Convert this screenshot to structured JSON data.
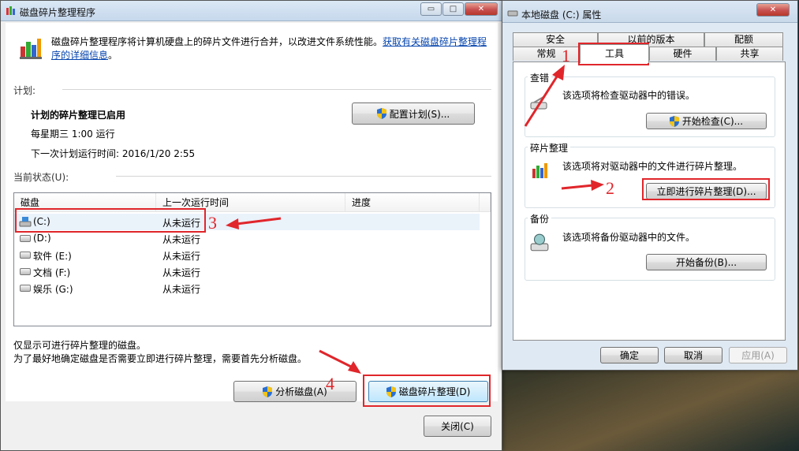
{
  "defrag_window": {
    "title": "磁盘碎片整理程序",
    "description": "磁盘碎片整理程序将计算机硬盘上的碎片文件进行合并，以改进文件系统性能。",
    "link_line1": "获取有关磁盘碎片整理程",
    "link_line2": "序的详细信息",
    "link_period": "。",
    "schedule_heading": "计划:",
    "schedule_status": "计划的碎片整理已启用",
    "schedule_when": "每星期三  1:00 运行",
    "schedule_next": "下一次计划运行时间: 2016/1/20 2:55",
    "configure_button": "配置计划(S)...",
    "current_status_heading": "当前状态(U):",
    "columns": [
      "磁盘",
      "上一次运行时间",
      "进度"
    ],
    "disks": [
      {
        "name": "(C:)",
        "last_run": "从未运行"
      },
      {
        "name": "(D:)",
        "last_run": "从未运行"
      },
      {
        "name": "软件 (E:)",
        "last_run": "从未运行"
      },
      {
        "name": "文档 (F:)",
        "last_run": "从未运行"
      },
      {
        "name": "娱乐 (G:)",
        "last_run": "从未运行"
      }
    ],
    "note1": "仅显示可进行碎片整理的磁盘。",
    "note2": "为了最好地确定磁盘是否需要立即进行碎片整理，需要首先分析磁盘。",
    "analyze_button": "分析磁盘(A)",
    "defrag_button": "磁盘碎片整理(D)",
    "close_button": "关闭(C)",
    "min_symbol": "▭",
    "max_symbol": "□",
    "close_symbol": "✕"
  },
  "properties_window": {
    "title": "本地磁盘 (C:) 属性",
    "tabs_row1": [
      "安全",
      "以前的版本",
      "配额"
    ],
    "tabs_row2": [
      "常规",
      "工具",
      "硬件",
      "共享"
    ],
    "errorcheck_label": "查错",
    "errorcheck_text": "该选项将检查驱动器中的错误。",
    "errorcheck_button": "开始检查(C)...",
    "defrag_label": "碎片整理",
    "defrag_text": "该选项将对驱动器中的文件进行碎片整理。",
    "defrag_button": "立即进行碎片整理(D)...",
    "backup_label": "备份",
    "backup_text": "该选项将备份驱动器中的文件。",
    "backup_button": "开始备份(B)...",
    "ok_button": "确定",
    "cancel_button": "取消",
    "apply_button": "应用(A)",
    "close_symbol": "✕"
  },
  "annotations": [
    "1",
    "2",
    "3",
    "4"
  ],
  "colors": {
    "annotation_red": "#e0262b",
    "link_blue": "#0645ad"
  }
}
